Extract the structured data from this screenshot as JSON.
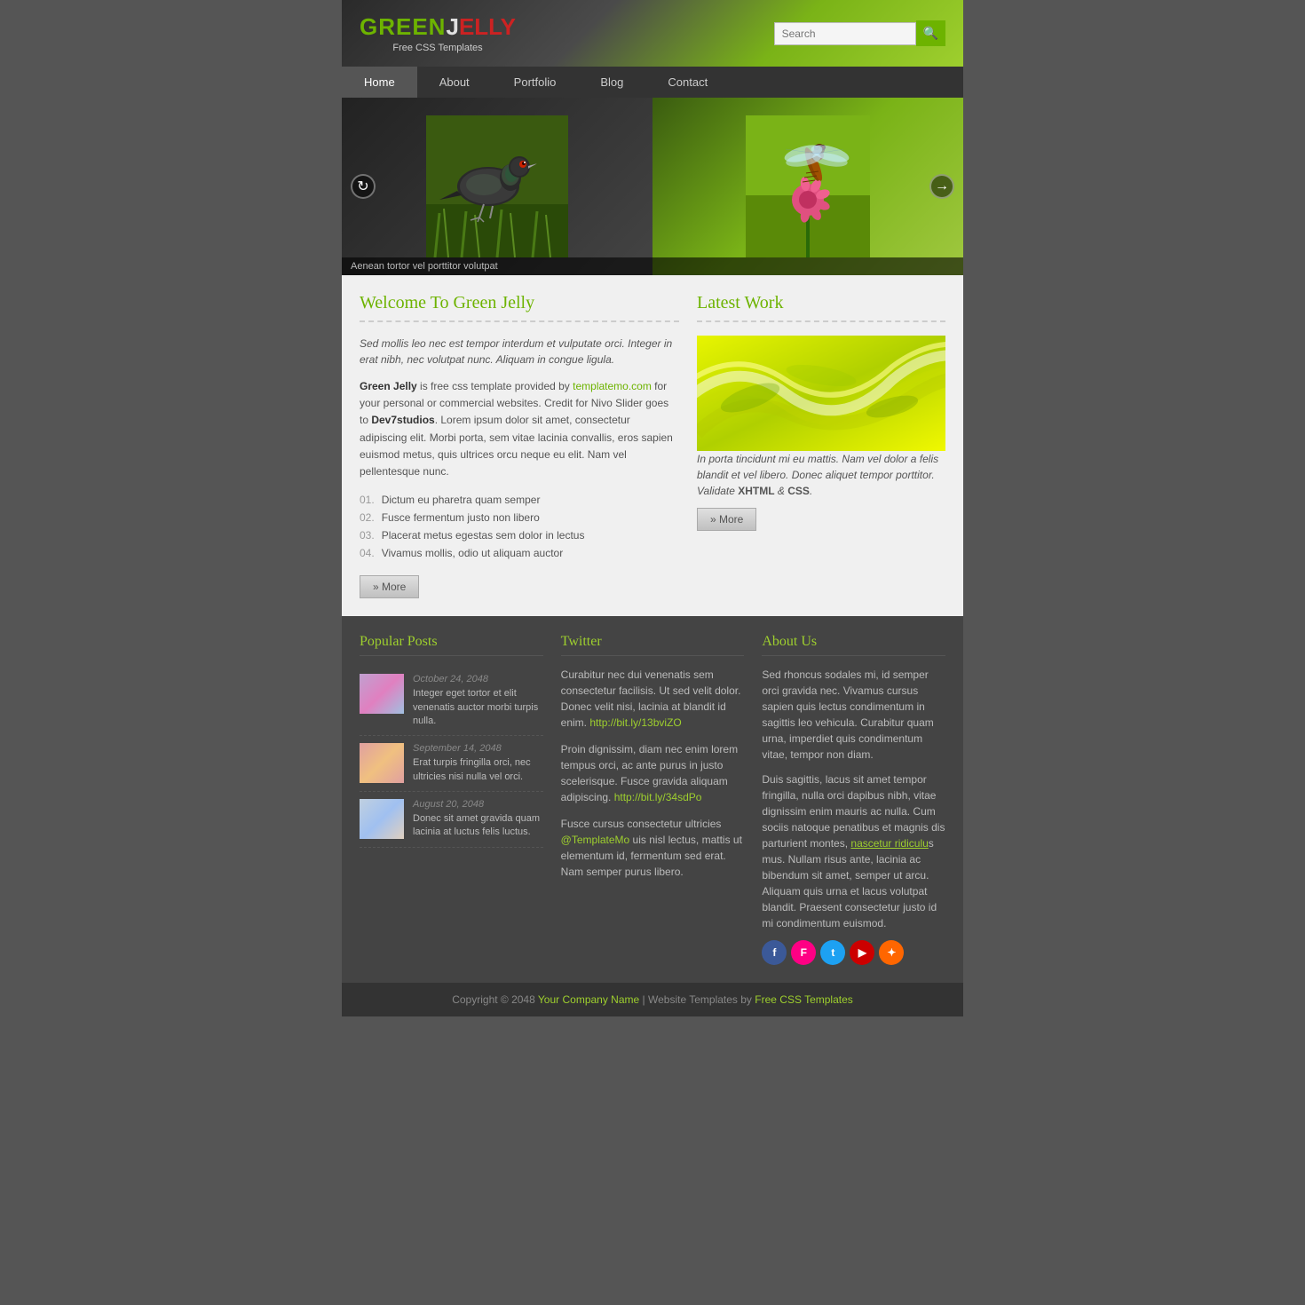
{
  "header": {
    "logo_green": "GREEN",
    "logo_white": "J",
    "logo_red": "ELLY",
    "logo_sub": "Free CSS Templates",
    "search_placeholder": "Search"
  },
  "nav": {
    "items": [
      "Home",
      "About",
      "Portfolio",
      "Blog",
      "Contact"
    ],
    "active": "Home"
  },
  "slider": {
    "caption": "Aenean tortor vel porttitor volutpat"
  },
  "main": {
    "welcome_title": "Welcome To Green Jelly",
    "intro": "Sed mollis leo nec est tempor interdum et vulputate orci. Integer in erat nibh, nec volutpat nunc. Aliquam in congue ligula.",
    "body1": "Green Jelly is free css template provided by templatemo.com for your personal or commercial websites. Credit for Nivo Slider goes to Dev7studios. Lorem ipsum dolor sit amet, consectetur adipiscing elit. Morbi porta, sem vitae lacinia convallis, eros sapien euismod metus, quis ultrices orcu neque eu elit. Nam vel pellentesque nunc.",
    "list": [
      "Dictum eu pharetra quam semper",
      "Fusce fermentum justo non libero",
      "Placerat metus egestas sem dolor in lectus",
      "Vivamus mollis, odio ut aliquam auctor"
    ],
    "more_label": "» More",
    "latest_title": "Latest Work",
    "work_caption": "In porta tincidunt mi eu mattis. Nam vel dolor a felis blandit et vel libero. Donec aliquet tempor porttitor. Validate XHTML & CSS.",
    "work_more": "» More"
  },
  "popular_posts": {
    "title": "Popular Posts",
    "posts": [
      {
        "date": "October 24, 2048",
        "text": "Integer eget tortor et elit venenatis auctor morbi turpis nulla."
      },
      {
        "date": "September 14, 2048",
        "text": "Erat turpis fringilla orci, nec ultricies nisi nulla vel orci."
      },
      {
        "date": "August 20, 2048",
        "text": "Donec sit amet gravida quam lacinia at luctus felis luctus."
      }
    ]
  },
  "twitter": {
    "title": "Twitter",
    "tweets": [
      {
        "text": "Curabitur nec dui venenatis sem consectetur facilisis. Ut sed velit dolor. Donec velit nisi, lacinia at blandit id enim.",
        "link": "http://bit.ly/13bviZO"
      },
      {
        "text": "Proin dignissim, diam nec enim lorem tempus orci, ac ante purus in justo scelerisque. Fusce gravida aliquam adipiscing.",
        "link": "http://bit.ly/34sdPo"
      },
      {
        "text": "Fusce cursus consectetur ultricies @TemplateMo uis nisl lectus, mattis ut elementum id, fermentum sed erat. Nam semper purus libero.",
        "link": null
      }
    ]
  },
  "about_us": {
    "title": "About Us",
    "text1": "Sed rhoncus sodales mi, id semper orci gravida nec. Vivamus cursus sapien quis lectus condimentum in sagittis leo vehicula. Curabitur quam urna, imperdiet quis condimentum vitae, tempor non diam.",
    "text2": "Duis sagittis, lacus sit amet tempor fringilla, nulla orci dapibus nibh, vitae dignissim enim mauris ac nulla. Cum sociis natoque penatibus et magnis dis parturient montes, nascetur ridiculus mus. Nullam risus ante, lacinia ac bibendum sit amet, semper ut arcu. Aliquam quis urna et lacus volutpat blandit. Praesent consectetur justo id mi condimentum euismod.",
    "social": {
      "facebook": "f",
      "flickr": "F",
      "twitter": "t",
      "youtube": "▶",
      "rss": "✦"
    }
  },
  "footer": {
    "text": "Copyright © 2048",
    "company": "Your Company Name",
    "separator": " | Website Templates by ",
    "templates": "Free CSS Templates"
  }
}
